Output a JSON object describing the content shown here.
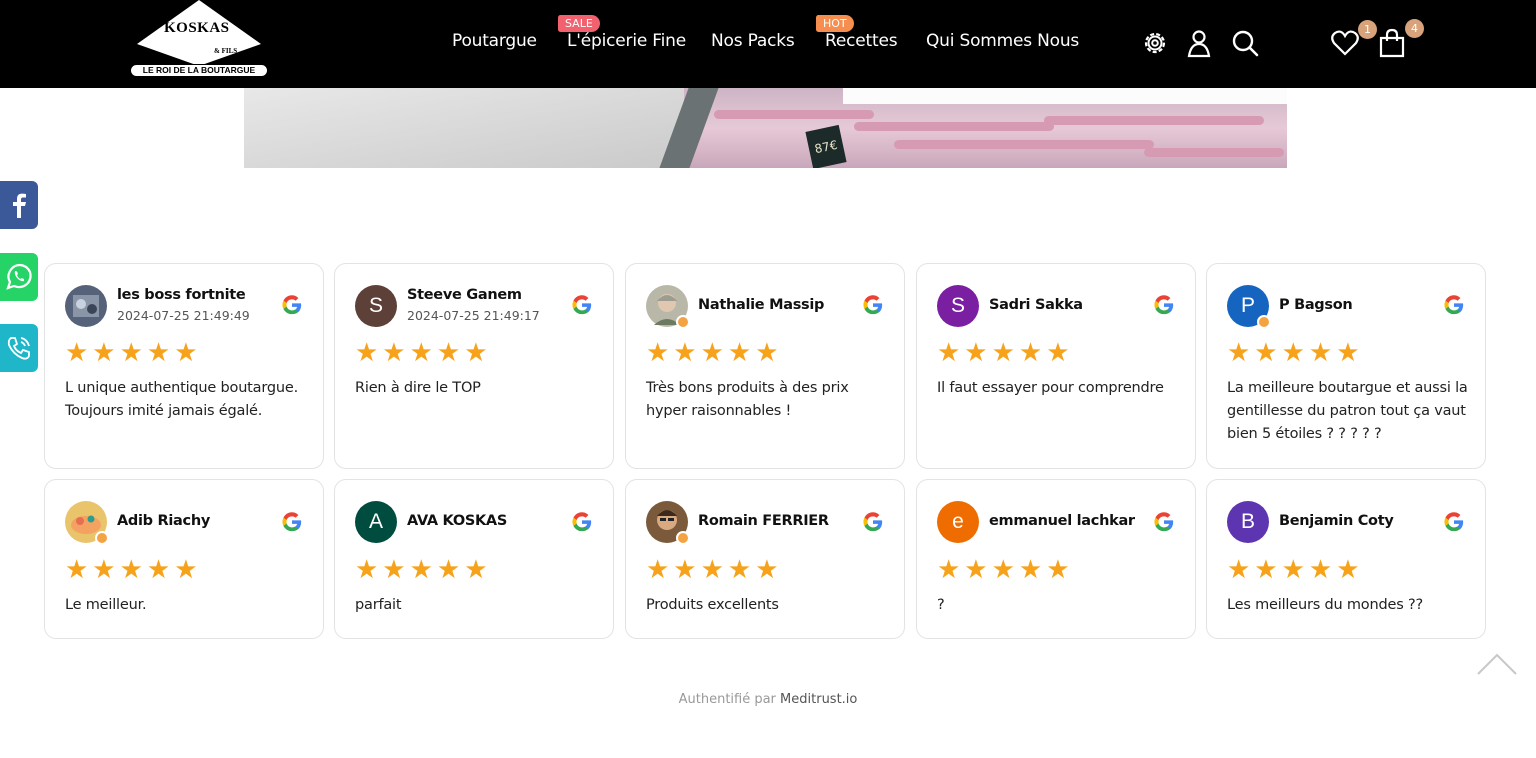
{
  "header": {
    "logo": {
      "text": "KOSKAS",
      "sub": "& FILS",
      "tagline": "LE ROI DE LA BOUTARGUE"
    },
    "nav": [
      {
        "label": "Poutargue",
        "badge": ""
      },
      {
        "label": "L'épicerie Fine",
        "badge": "SALE"
      },
      {
        "label": "Nos Packs",
        "badge": ""
      },
      {
        "label": "Recettes",
        "badge": "HOT"
      },
      {
        "label": "Qui Sommes Nous",
        "badge": ""
      }
    ],
    "icons": [
      "settings-icon",
      "user-icon",
      "search-icon",
      "heart-icon",
      "bag-icon"
    ],
    "wishlist_count": "1",
    "cart_count": "4",
    "colors": {
      "background": "#000000",
      "sale": "#f2616e",
      "hot": "#f58e4e",
      "count": "#d8a37a"
    }
  },
  "banner": {
    "price_sign": "87€"
  },
  "social": [
    "facebook-icon",
    "whatsapp-icon",
    "phone-icon"
  ],
  "reviews": [
    {
      "name": "les boss fortnite",
      "date": "2024-07-25 21:49:49",
      "initial": "",
      "avatar_color": "#556070",
      "rating": 5,
      "text": "L unique authentique boutargue. Toujours imité jamais égalé."
    },
    {
      "name": "Steeve Ganem",
      "date": "2024-07-25 21:49:17",
      "initial": "S",
      "avatar_color": "#5d4037",
      "rating": 5,
      "text": "Rien à dire le TOP"
    },
    {
      "name": "Nathalie Massip",
      "date": "",
      "initial": "",
      "avatar_color": "#9a9a8a",
      "rating": 5,
      "text": "Très bons produits à des prix hyper raisonnables !"
    },
    {
      "name": "Sadri Sakka",
      "date": "",
      "initial": "S",
      "avatar_color": "#7b1fa2",
      "rating": 5,
      "text": "Il faut essayer pour comprendre"
    },
    {
      "name": "P Bagson",
      "date": "",
      "initial": "P",
      "avatar_color": "#1565c0",
      "rating": 5,
      "text": "La meilleure boutargue et aussi la gentillesse du patron tout ça vaut bien 5 étoiles ? ? ? ? ?"
    },
    {
      "name": "Adib Riachy",
      "date": "",
      "initial": "",
      "avatar_color": "#d9a441",
      "rating": 5,
      "text": "Le meilleur."
    },
    {
      "name": "AVA KOSKAS",
      "date": "",
      "initial": "A",
      "avatar_color": "#004d40",
      "rating": 5,
      "text": "parfait"
    },
    {
      "name": "Romain FERRIER",
      "date": "",
      "initial": "",
      "avatar_color": "#8d6e4a",
      "rating": 5,
      "text": "Produits excellents"
    },
    {
      "name": "emmanuel lachkar",
      "date": "",
      "initial": "e",
      "avatar_color": "#ef6c00",
      "rating": 5,
      "text": "?"
    },
    {
      "name": "Benjamin Coty",
      "date": "",
      "initial": "B",
      "avatar_color": "#5e35b1",
      "rating": 5,
      "text": "Les meilleurs du mondes ??"
    }
  ],
  "stars": "★★★★★",
  "footer": {
    "auth_prefix": "Authentifié par",
    "auth_brand": "Meditrust.io"
  }
}
